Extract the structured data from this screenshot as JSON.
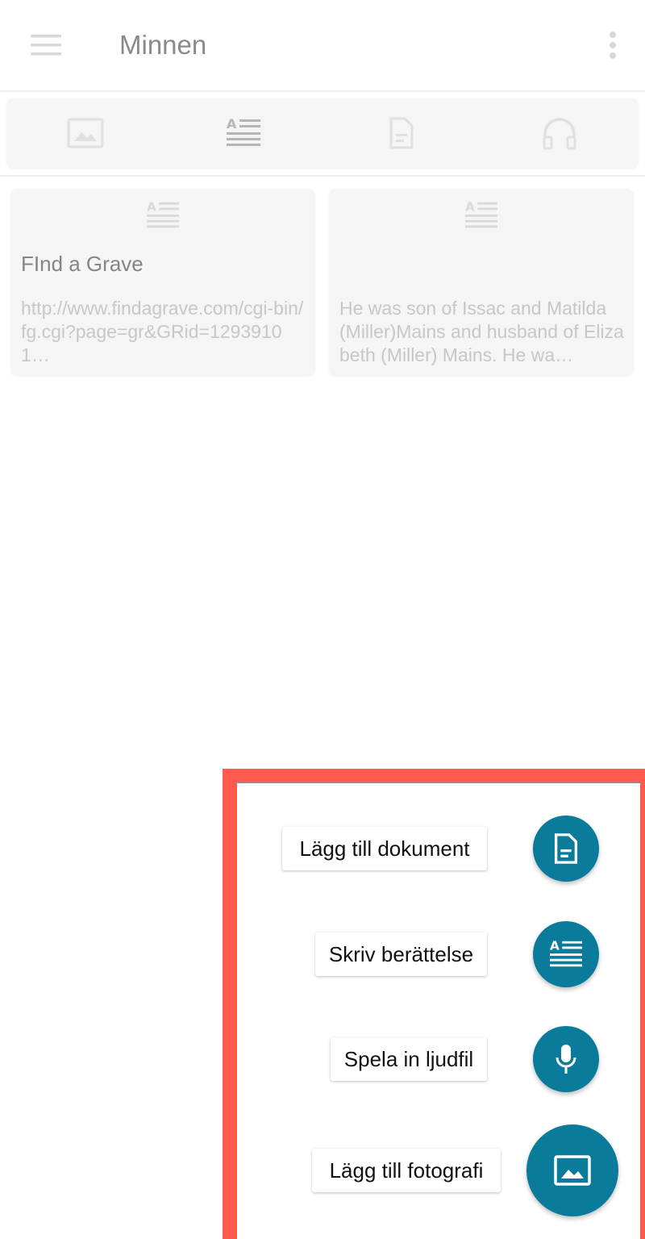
{
  "app_bar": {
    "title": "Minnen",
    "menu_icon": "hamburger-menu-icon",
    "more_icon": "more-vert-icon"
  },
  "filters": [
    {
      "icon": "image-icon"
    },
    {
      "icon": "story-text-icon"
    },
    {
      "icon": "document-icon"
    },
    {
      "icon": "headphones-icon"
    }
  ],
  "cards": [
    {
      "icon": "story-text-icon",
      "title": "FInd a Grave",
      "text": "http://www.findagrave.com/cgi-bin/fg.cgi?page=gr&GRid=12939101…"
    },
    {
      "icon": "story-text-icon",
      "title": "",
      "text": "He was son of Issac and Matilda (Miller)Mains and husband of Elizabeth (Miller) Mains. He wa…"
    }
  ],
  "fab_menu": {
    "items": [
      {
        "label": "Lägg till dokument",
        "icon": "document-icon"
      },
      {
        "label": "Skriv berättelse",
        "icon": "story-text-icon"
      },
      {
        "label": "Spela in ljudfil",
        "icon": "microphone-icon"
      },
      {
        "label": "Lägg till fotografi",
        "icon": "image-icon"
      }
    ]
  },
  "colors": {
    "fab": "#0a7b9b",
    "highlight": "#fe5a4e",
    "disabled_icon": "#d9d9d9",
    "card_bg": "#f5f5f5"
  }
}
